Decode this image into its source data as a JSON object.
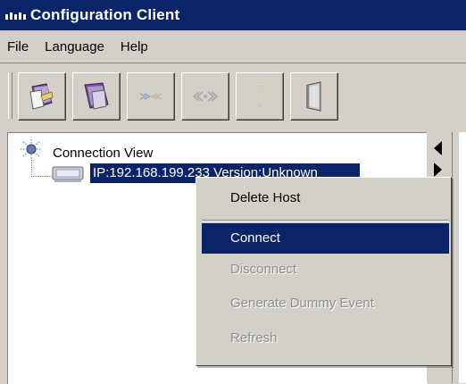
{
  "window": {
    "title": "Configuration Client"
  },
  "menubar": {
    "items": [
      "File",
      "Language",
      "Help"
    ]
  },
  "toolbar": {
    "buttons": [
      {
        "icon": "add-host-icon",
        "enabled": true
      },
      {
        "icon": "remove-host-icon",
        "enabled": true
      },
      {
        "icon": "connect-icon",
        "enabled": false
      },
      {
        "icon": "disconnect-icon",
        "enabled": false
      },
      {
        "icon": "help-icon",
        "enabled": false
      },
      {
        "icon": "exit-door-icon",
        "enabled": true
      }
    ]
  },
  "tree": {
    "root_label": "Connection View",
    "host_label": "IP:192.168.199.233 Version:Unknown"
  },
  "context_menu": {
    "items": [
      {
        "label": "Delete Host",
        "state": "enabled"
      },
      {
        "label": "Connect",
        "state": "selected"
      },
      {
        "label": "Disconnect",
        "state": "disabled"
      },
      {
        "label": "Generate Dummy Event",
        "state": "disabled"
      },
      {
        "label": "Refresh",
        "state": "disabled"
      }
    ]
  },
  "colors": {
    "selection": "#0a246a",
    "face": "#d4d0c8",
    "disabled_text": "#8f8f8f"
  }
}
